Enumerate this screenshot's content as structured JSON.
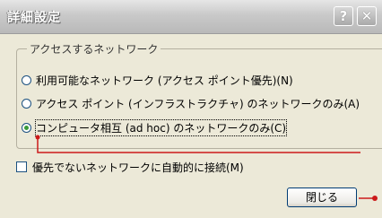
{
  "window": {
    "title": "詳細設定",
    "help_label": "?",
    "close_label": "✕"
  },
  "group": {
    "legend": "アクセスするネットワーク",
    "options": [
      {
        "label": "利用可能なネットワーク (アクセス ポイント優先)(N)",
        "selected": false
      },
      {
        "label": "アクセス ポイント (インフラストラクチャ) のネットワークのみ(A)",
        "selected": false
      },
      {
        "label": "コンピュータ相互 (ad hoc) のネットワークのみ(C)",
        "selected": true
      }
    ]
  },
  "auto_connect": {
    "label": "優先でないネットワークに自動的に接続(M)",
    "checked": false
  },
  "footer": {
    "close_button": "閉じる"
  },
  "colors": {
    "annotation": "#cc1a1a"
  }
}
